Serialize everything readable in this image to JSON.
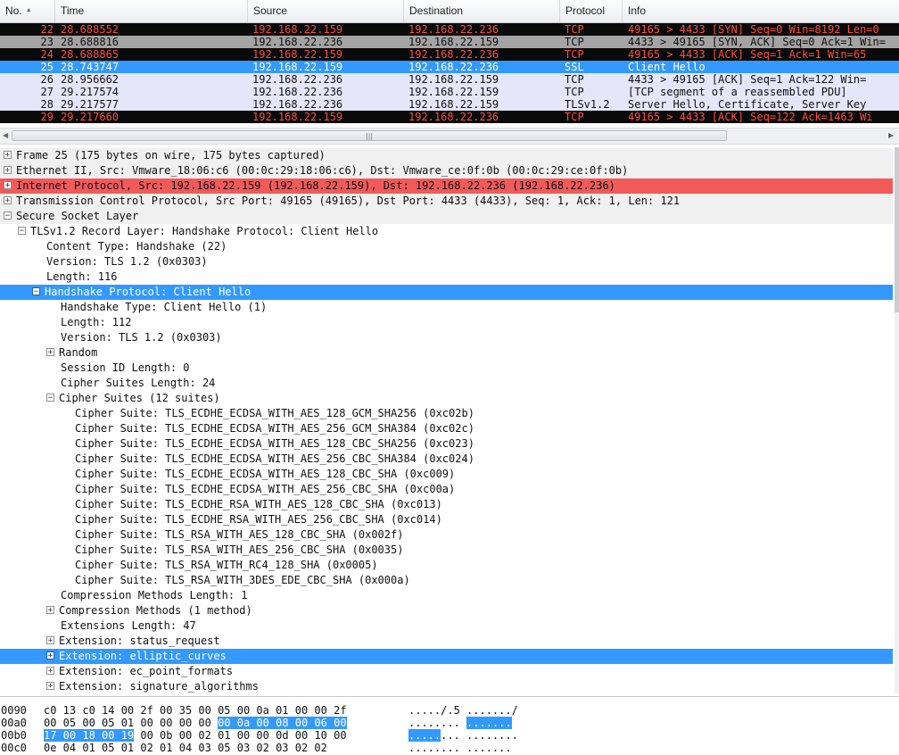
{
  "columns": [
    "No.",
    "Time",
    "Source",
    "Destination",
    "Protocol",
    "Info"
  ],
  "sort_indicator": "▲",
  "colors": {
    "black_bg": "#0a0a0a",
    "red_text": "#ff4d3d",
    "gray_bg": "#a4a4a4",
    "selected_bg": "#3399ff",
    "light_bg": "#e6e6fb",
    "red_row": "#f25a5a"
  },
  "packets": [
    {
      "no": "22",
      "time": "28.688552",
      "src": "192.168.22.159",
      "dst": "192.168.22.236",
      "proto": "TCP",
      "info": "49165 > 4433 [SYN] Seq=0 Win=8192 Len=0",
      "style": "black"
    },
    {
      "no": "23",
      "time": "28.688816",
      "src": "192.168.22.236",
      "dst": "192.168.22.159",
      "proto": "TCP",
      "info": "4433 > 49165 [SYN, ACK] Seq=0 Ack=1 Win=",
      "style": "gray"
    },
    {
      "no": "24",
      "time": "28.688865",
      "src": "192.168.22.159",
      "dst": "192.168.22.236",
      "proto": "TCP",
      "info": "49165 > 4433 [ACK] Seq=1 Ack=1 Win=65",
      "style": "black"
    },
    {
      "no": "25",
      "time": "28.743747",
      "src": "192.168.22.159",
      "dst": "192.168.22.236",
      "proto": "SSL",
      "info": "Client Hello",
      "style": "selected"
    },
    {
      "no": "26",
      "time": "28.956662",
      "src": "192.168.22.236",
      "dst": "192.168.22.159",
      "proto": "TCP",
      "info": "4433 > 49165 [ACK] Seq=1 Ack=122 Win=",
      "style": "light"
    },
    {
      "no": "27",
      "time": "29.217574",
      "src": "192.168.22.236",
      "dst": "192.168.22.159",
      "proto": "TCP",
      "info": "[TCP segment of a reassembled PDU]",
      "style": "light"
    },
    {
      "no": "28",
      "time": "29.217577",
      "src": "192.168.22.236",
      "dst": "192.168.22.159",
      "proto": "TLSv1.2",
      "info": "Server Hello, Certificate, Server Key",
      "style": "light"
    },
    {
      "no": "29",
      "time": "29.217660",
      "src": "192.168.22.159",
      "dst": "192.168.22.236",
      "proto": "TCP",
      "info": "49165 > 4433 [ACK] Seq=122 Ack=1463 Wi",
      "style": "black"
    }
  ],
  "tree": [
    {
      "indent": 0,
      "exp": "+",
      "text": "Frame 25 (175 bytes on wire, 175 bytes captured)",
      "style": "gray"
    },
    {
      "indent": 0,
      "exp": "+",
      "text": "Ethernet II, Src: Vmware_18:06:c6 (00:0c:29:18:06:c6), Dst: Vmware_ce:0f:0b (00:0c:29:ce:0f:0b)",
      "style": "gray"
    },
    {
      "indent": 0,
      "exp": "+",
      "text": "Internet Protocol, Src: 192.168.22.159 (192.168.22.159), Dst: 192.168.22.236 (192.168.22.236)",
      "style": "red"
    },
    {
      "indent": 0,
      "exp": "+",
      "text": "Transmission Control Protocol, Src Port: 49165 (49165), Dst Port: 4433 (4433), Seq: 1, Ack: 1, Len: 121",
      "style": "gray"
    },
    {
      "indent": 0,
      "exp": "−",
      "text": "Secure Socket Layer",
      "style": "gray"
    },
    {
      "indent": 1,
      "exp": "−",
      "text": "TLSv1.2 Record Layer: Handshake Protocol: Client Hello",
      "style": ""
    },
    {
      "indent": 2,
      "exp": "",
      "text": "Content Type: Handshake (22)",
      "style": ""
    },
    {
      "indent": 2,
      "exp": "",
      "text": "Version: TLS 1.2 (0x0303)",
      "style": ""
    },
    {
      "indent": 2,
      "exp": "",
      "text": "Length: 116",
      "style": ""
    },
    {
      "indent": 2,
      "exp": "−",
      "text": "Handshake Protocol: Client Hello",
      "style": "sel"
    },
    {
      "indent": 3,
      "exp": "",
      "text": "Handshake Type: Client Hello (1)",
      "style": ""
    },
    {
      "indent": 3,
      "exp": "",
      "text": "Length: 112",
      "style": ""
    },
    {
      "indent": 3,
      "exp": "",
      "text": "Version: TLS 1.2 (0x0303)",
      "style": ""
    },
    {
      "indent": 3,
      "exp": "+",
      "text": "Random",
      "style": ""
    },
    {
      "indent": 3,
      "exp": "",
      "text": "Session ID Length: 0",
      "style": ""
    },
    {
      "indent": 3,
      "exp": "",
      "text": "Cipher Suites Length: 24",
      "style": ""
    },
    {
      "indent": 3,
      "exp": "−",
      "text": "Cipher Suites (12 suites)",
      "style": ""
    },
    {
      "indent": 4,
      "exp": "",
      "text": "Cipher Suite: TLS_ECDHE_ECDSA_WITH_AES_128_GCM_SHA256 (0xc02b)",
      "style": ""
    },
    {
      "indent": 4,
      "exp": "",
      "text": "Cipher Suite: TLS_ECDHE_ECDSA_WITH_AES_256_GCM_SHA384 (0xc02c)",
      "style": ""
    },
    {
      "indent": 4,
      "exp": "",
      "text": "Cipher Suite: TLS_ECDHE_ECDSA_WITH_AES_128_CBC_SHA256 (0xc023)",
      "style": ""
    },
    {
      "indent": 4,
      "exp": "",
      "text": "Cipher Suite: TLS_ECDHE_ECDSA_WITH_AES_256_CBC_SHA384 (0xc024)",
      "style": ""
    },
    {
      "indent": 4,
      "exp": "",
      "text": "Cipher Suite: TLS_ECDHE_ECDSA_WITH_AES_128_CBC_SHA (0xc009)",
      "style": ""
    },
    {
      "indent": 4,
      "exp": "",
      "text": "Cipher Suite: TLS_ECDHE_ECDSA_WITH_AES_256_CBC_SHA (0xc00a)",
      "style": ""
    },
    {
      "indent": 4,
      "exp": "",
      "text": "Cipher Suite: TLS_ECDHE_RSA_WITH_AES_128_CBC_SHA (0xc013)",
      "style": ""
    },
    {
      "indent": 4,
      "exp": "",
      "text": "Cipher Suite: TLS_ECDHE_RSA_WITH_AES_256_CBC_SHA (0xc014)",
      "style": ""
    },
    {
      "indent": 4,
      "exp": "",
      "text": "Cipher Suite: TLS_RSA_WITH_AES_128_CBC_SHA (0x002f)",
      "style": ""
    },
    {
      "indent": 4,
      "exp": "",
      "text": "Cipher Suite: TLS_RSA_WITH_AES_256_CBC_SHA (0x0035)",
      "style": ""
    },
    {
      "indent": 4,
      "exp": "",
      "text": "Cipher Suite: TLS_RSA_WITH_RC4_128_SHA (0x0005)",
      "style": ""
    },
    {
      "indent": 4,
      "exp": "",
      "text": "Cipher Suite: TLS_RSA_WITH_3DES_EDE_CBC_SHA (0x000a)",
      "style": ""
    },
    {
      "indent": 3,
      "exp": "",
      "text": "Compression Methods Length: 1",
      "style": ""
    },
    {
      "indent": 3,
      "exp": "+",
      "text": "Compression Methods (1 method)",
      "style": ""
    },
    {
      "indent": 3,
      "exp": "",
      "text": "Extensions Length: 47",
      "style": ""
    },
    {
      "indent": 3,
      "exp": "+",
      "text": "Extension: status_request",
      "style": ""
    },
    {
      "indent": 3,
      "exp": "+",
      "text": "Extension: elliptic_curves",
      "style": "sel"
    },
    {
      "indent": 3,
      "exp": "+",
      "text": "Extension: ec_point_formats",
      "style": ""
    },
    {
      "indent": 3,
      "exp": "+",
      "text": "Extension: signature_algorithms",
      "style": ""
    }
  ],
  "bytes": [
    {
      "offset": "0090",
      "hex": [
        {
          "t": "c0 13 c0 14 00 2f 00 35  00 05 00 0a 01 00 00 2f"
        }
      ],
      "ascii": [
        {
          "t": "...../.5 ......./"
        }
      ]
    },
    {
      "offset": "00a0",
      "hex": [
        {
          "t": "00 05 00 05 01 00 00 00  00 "
        },
        {
          "t": "00 0a 00 08 00 06 00",
          "sel": true
        }
      ],
      "ascii": [
        {
          "t": "........ "
        },
        {
          "t": ".......",
          "sel": true
        }
      ]
    },
    {
      "offset": "00b0",
      "hex": [
        {
          "t": "17 00 18 00 19",
          "sel": true
        },
        {
          "t": " 00 0b 00  02 01 00 00 0d 00 10 00"
        }
      ],
      "ascii": [
        {
          "t": ".....",
          "sel": true
        },
        {
          "t": "... ........"
        }
      ]
    },
    {
      "offset": "00c0",
      "hex": [
        {
          "t": "0e 04 01 05 01 02 01 04  03 05 03 02 03 02 02"
        }
      ],
      "ascii": [
        {
          "t": "........ ......."
        }
      ]
    }
  ]
}
